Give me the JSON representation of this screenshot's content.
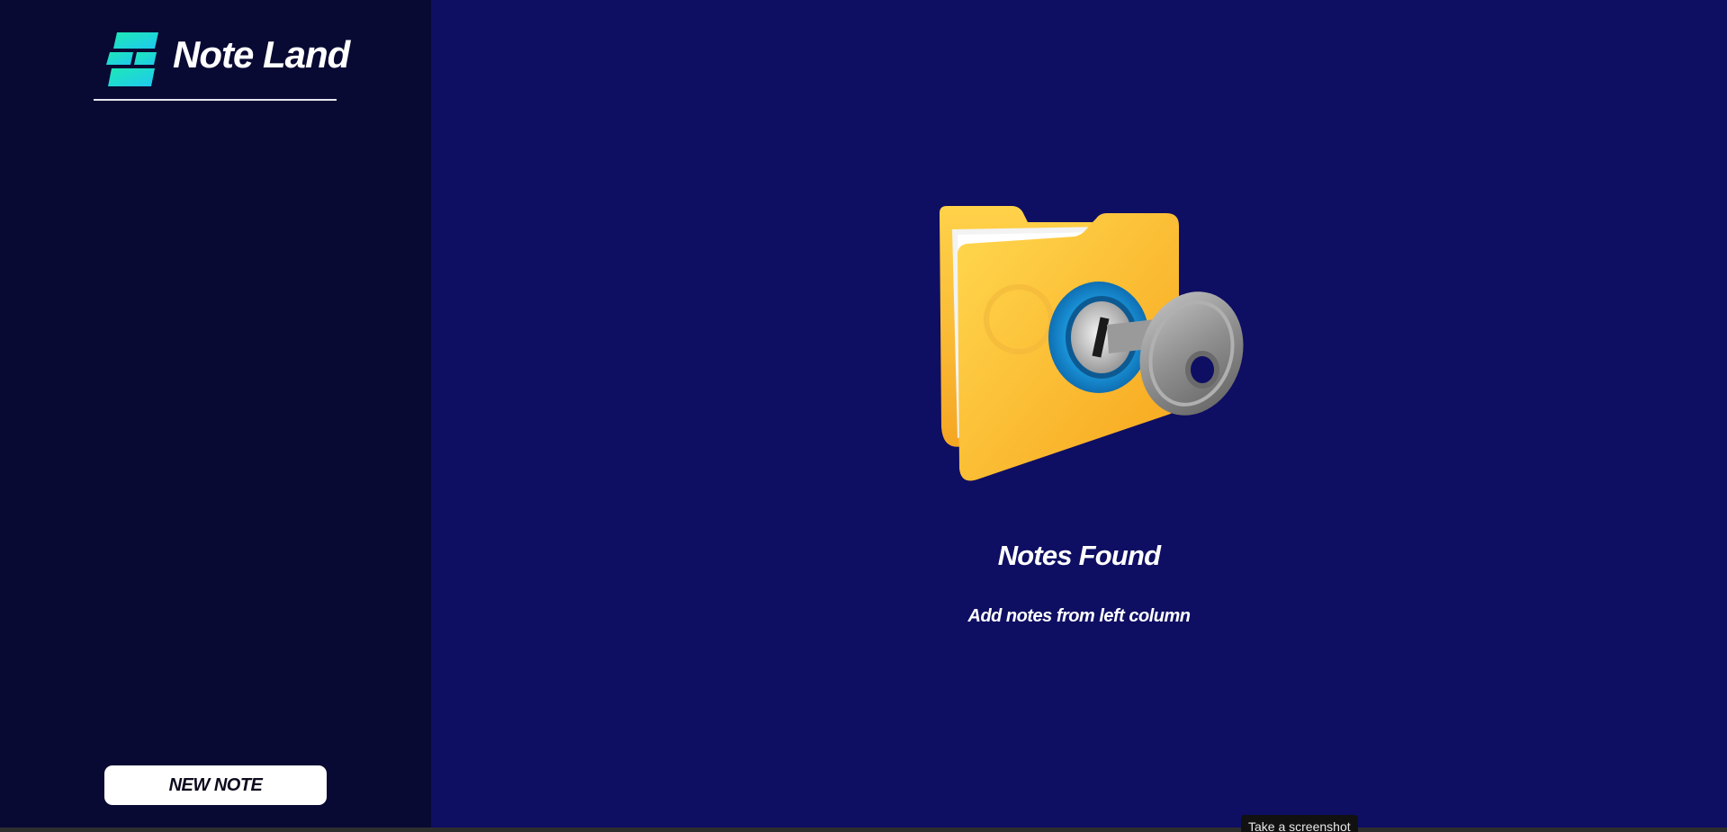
{
  "app": {
    "title": "Note Land",
    "logo_icon": "app-logo-icon",
    "colors": {
      "sidebar_bg": "#090a33",
      "main_bg": "#0e0e63",
      "logo_gradient_start": "#1de9b6",
      "logo_gradient_end": "#1fc8f0",
      "button_bg": "#ffffff"
    }
  },
  "sidebar": {
    "new_note_label": "NEW NOTE"
  },
  "main": {
    "empty_state": {
      "illustration_icon": "locked-folder-with-key-icon",
      "title": "Notes Found",
      "subtitle": "Add notes from left column"
    }
  },
  "tooltip": {
    "text": "Take a screenshot"
  }
}
